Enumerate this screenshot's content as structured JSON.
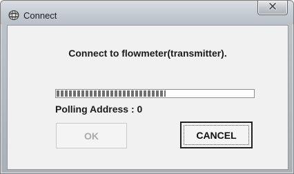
{
  "window": {
    "title": "Connect",
    "title_icon": "app-globe-icon",
    "close_icon": "close-x-icon"
  },
  "dialog": {
    "message": "Connect to flowmeter(transmitter).",
    "progress_fraction": 0.55,
    "polling_text": "Polling Address : 0",
    "ok_label": "OK",
    "ok_enabled": false,
    "cancel_label": "CANCEL"
  },
  "colors": {
    "titlebar": "#c5ccd2",
    "client_background": "#f1f1f1",
    "progress_segment": "#6f6f6f",
    "disabled_text": "#a9a9a9"
  }
}
